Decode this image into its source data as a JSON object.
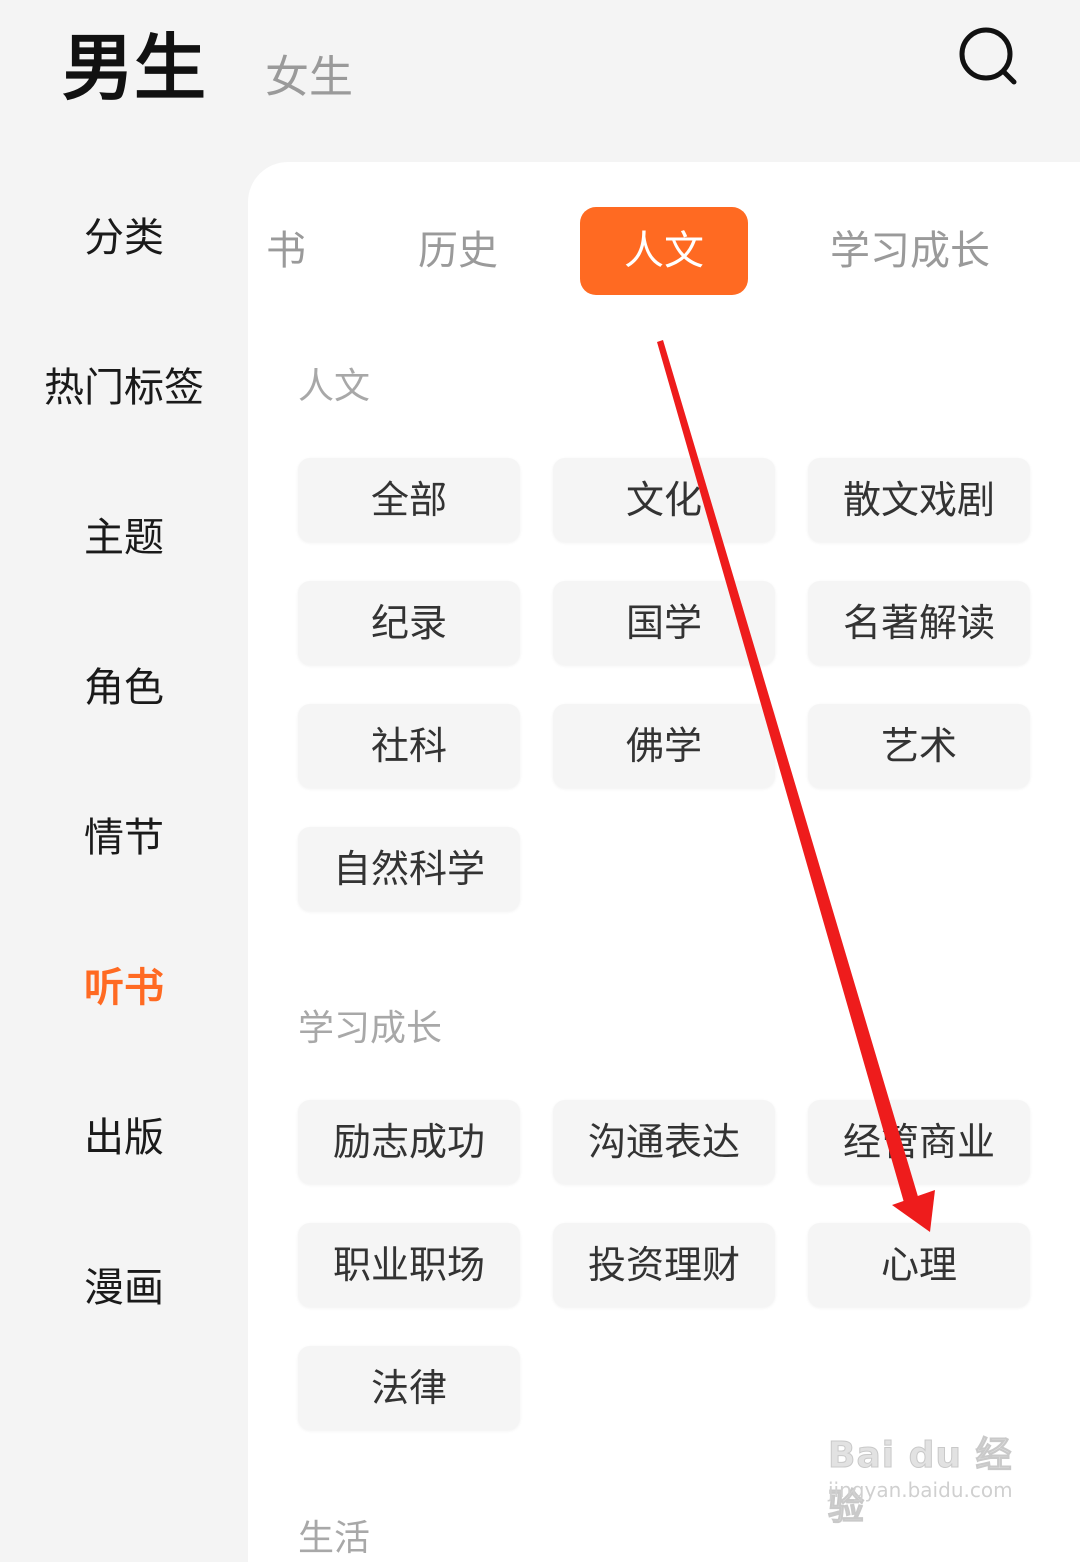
{
  "header": {
    "tab_male": "男生",
    "tab_female": "女生",
    "search_icon": "search-icon"
  },
  "sidebar": {
    "items": [
      {
        "label": "分类",
        "active": false
      },
      {
        "label": "热门标签",
        "active": false
      },
      {
        "label": "主题",
        "active": false
      },
      {
        "label": "角色",
        "active": false
      },
      {
        "label": "情节",
        "active": false
      },
      {
        "label": "听书",
        "active": true
      },
      {
        "label": "出版",
        "active": false
      },
      {
        "label": "漫画",
        "active": false
      }
    ]
  },
  "category_tabs": [
    {
      "label": "书",
      "clipped": true
    },
    {
      "label": "历史"
    },
    {
      "label": "人文",
      "active": true
    },
    {
      "label": "学习成长"
    }
  ],
  "sections": [
    {
      "title": "人文",
      "chips": [
        "全部",
        "文化",
        "散文戏剧",
        "纪录",
        "国学",
        "名著解读",
        "社科",
        "佛学",
        "艺术",
        "自然科学"
      ]
    },
    {
      "title": "学习成长",
      "chips": [
        "励志成功",
        "沟通表达",
        "经管商业",
        "职业职场",
        "投资理财",
        "心理",
        "法律"
      ]
    },
    {
      "title": "生活",
      "chips": []
    }
  ],
  "colors": {
    "accent": "#ff6a22",
    "arrow": "#ee1c1c"
  },
  "watermark": {
    "text": "Bai du 经验",
    "sub": "jingyan.baidu.com"
  }
}
